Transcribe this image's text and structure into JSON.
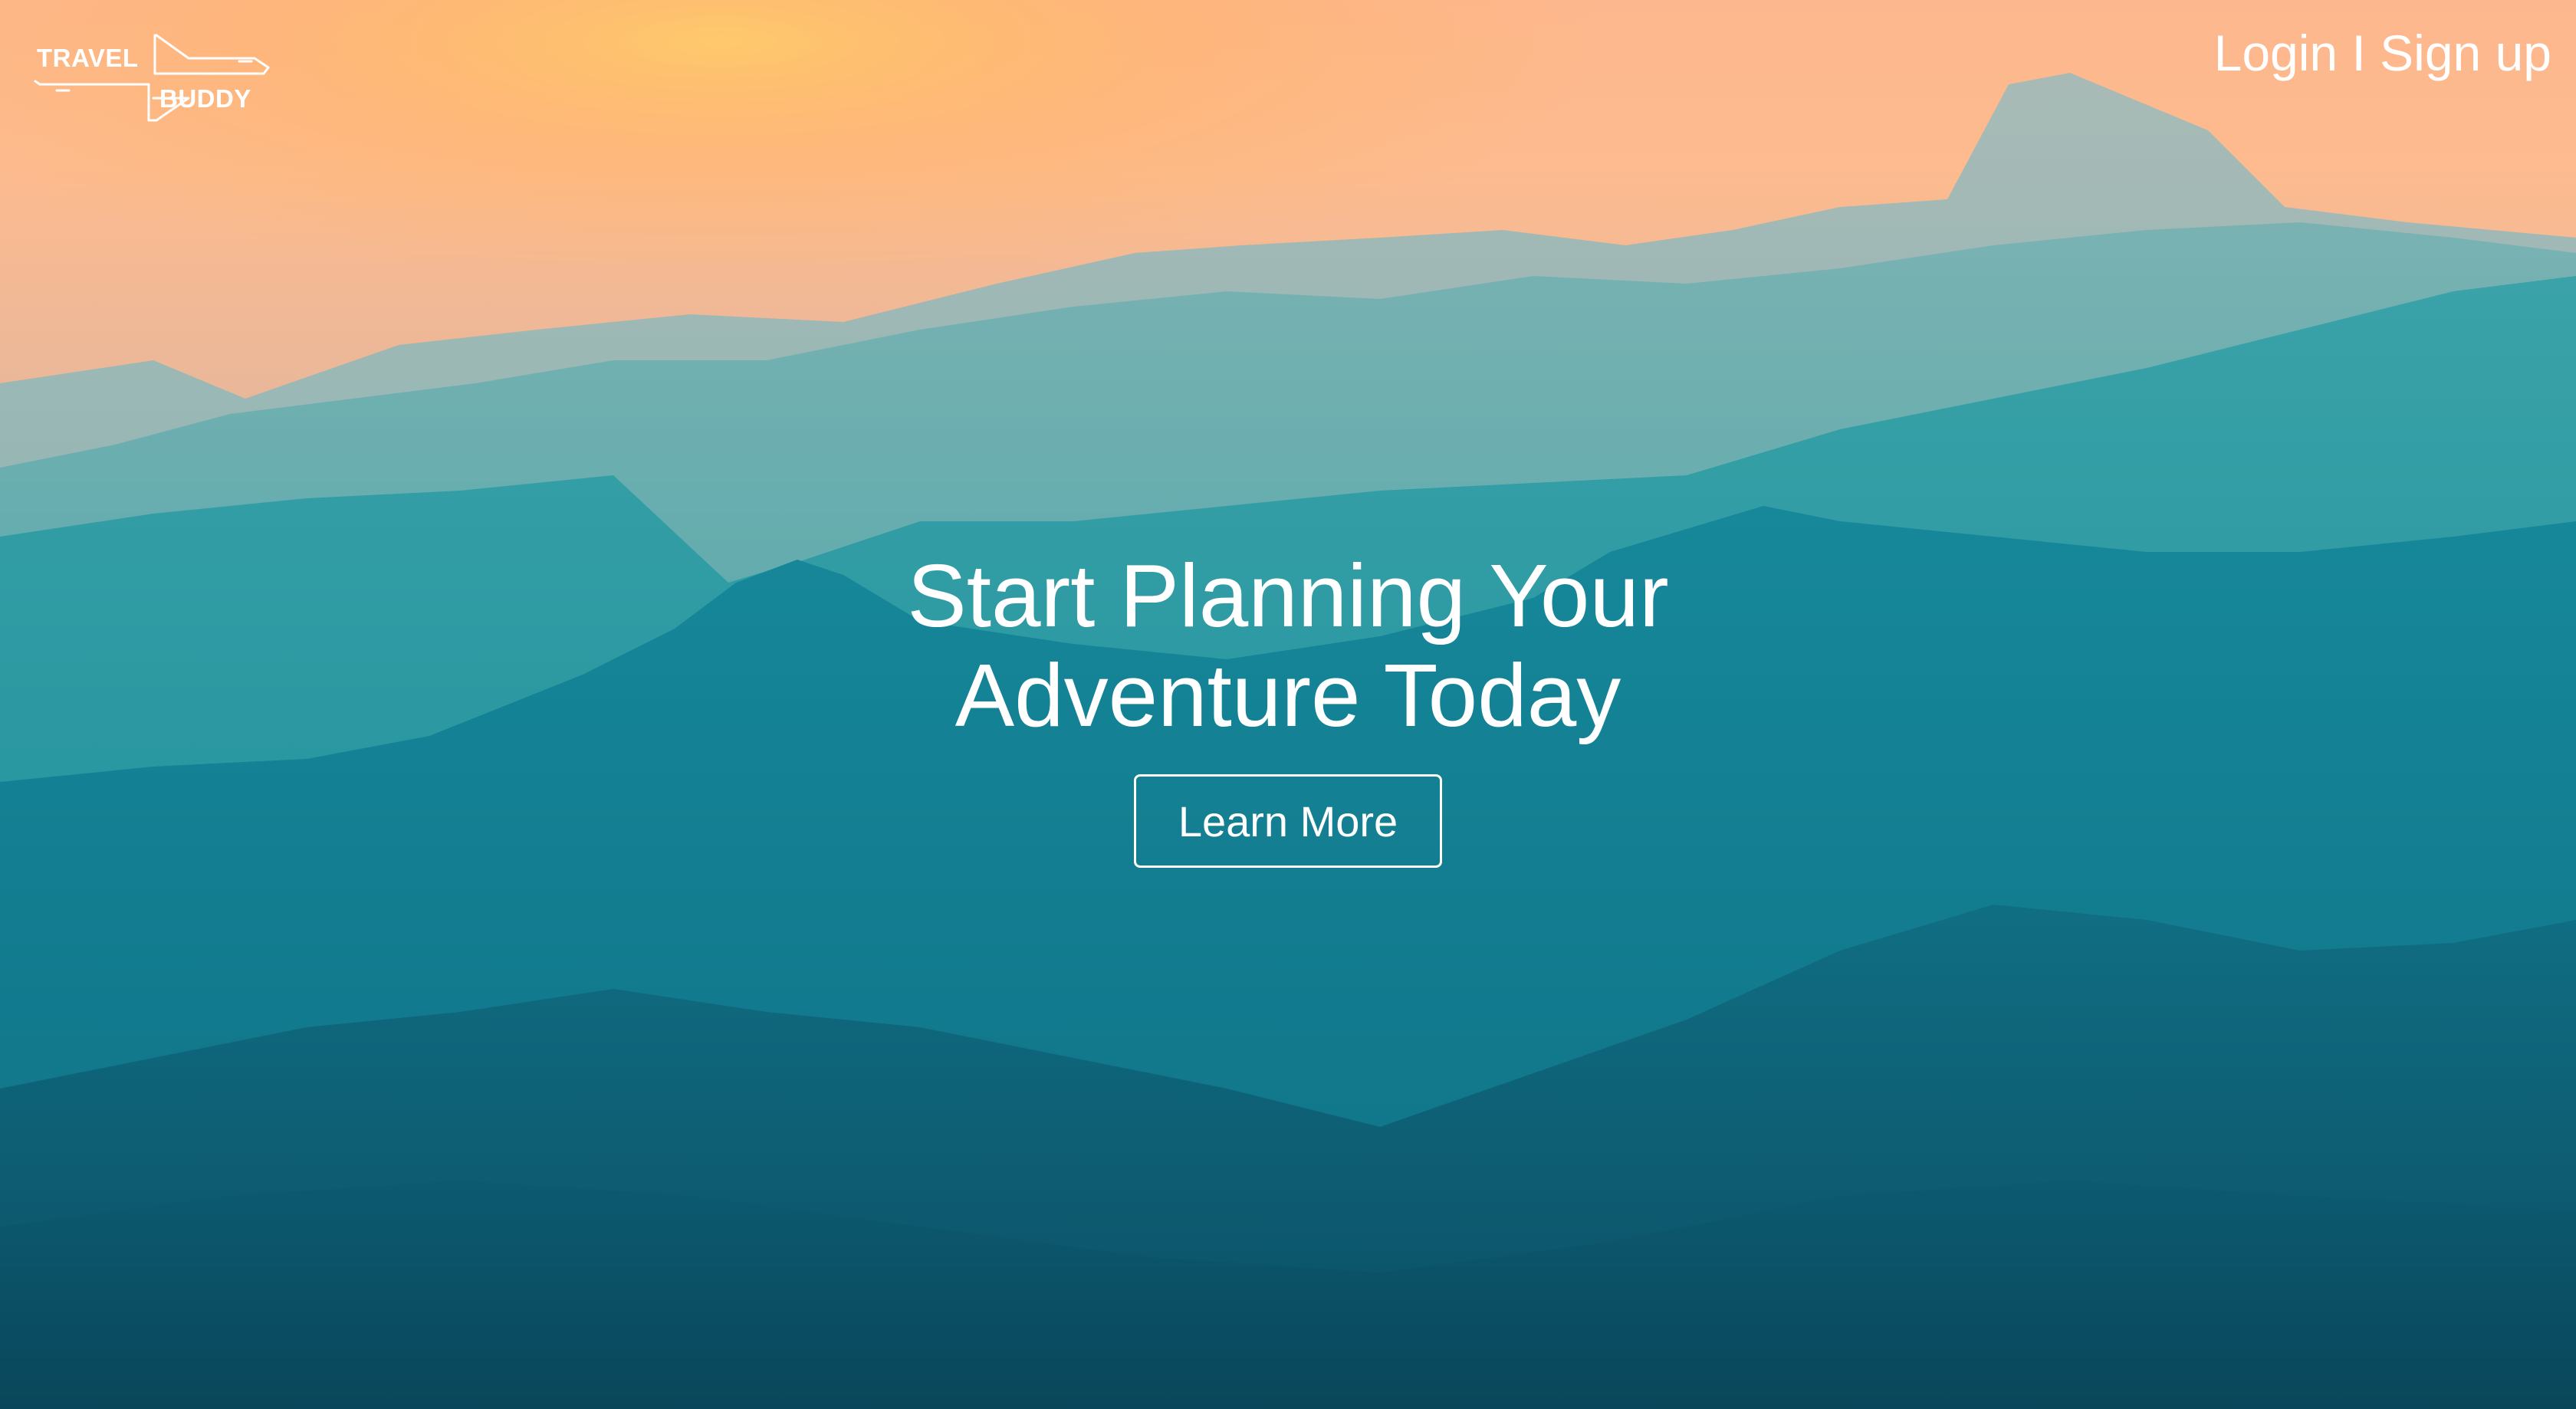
{
  "brand": {
    "logo_line1": "TRAVEL",
    "logo_line2": "BUDDY",
    "icon": "airplane-outline-icon"
  },
  "nav": {
    "login_label": "Login",
    "separator": "I",
    "signup_label": "Sign up"
  },
  "hero": {
    "title_line1": "Start Planning Your",
    "title_line2": "Adventure Today",
    "cta_label": "Learn More"
  },
  "colors": {
    "sky_top": "#fdbd8f",
    "sky_glow": "#ffb44f",
    "mountain_light": "#3aa6a9",
    "mountain_mid": "#138f9c",
    "mountain_dark": "#0b4a5e",
    "text": "#ffffff"
  }
}
